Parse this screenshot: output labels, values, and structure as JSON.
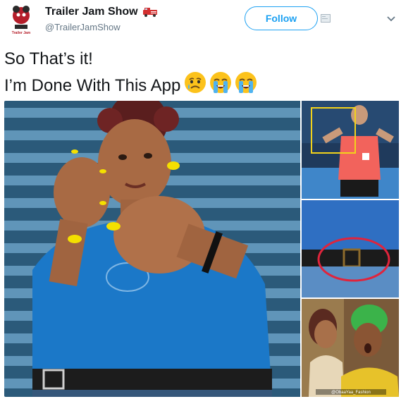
{
  "account": {
    "display_name": "Trailer Jam Show",
    "name_emoji": "fire-engine",
    "handle": "@TrailerJamShow",
    "avatar_text": "Trailer Jam"
  },
  "actions": {
    "follow_label": "Follow",
    "menu_icon": "chevron-down-icon"
  },
  "tweet": {
    "line1": "So That’s it!",
    "line2": "I’m Done With This App",
    "emojis": [
      "sad-but-relieved-face",
      "loudly-crying-face",
      "loudly-crying-face"
    ]
  },
  "media": {
    "photos": [
      "woman-blue-shirt",
      "referee-highlighted",
      "belt-circled",
      "surprised-woman-green-headwrap"
    ],
    "watermark": "@ObaaYaa_Fashion"
  },
  "colors": {
    "accent": "#1da1f2",
    "handle": "#657786",
    "text": "#14171a",
    "highlight_yellow": "#f2d21b",
    "highlight_red": "#e0243c"
  }
}
